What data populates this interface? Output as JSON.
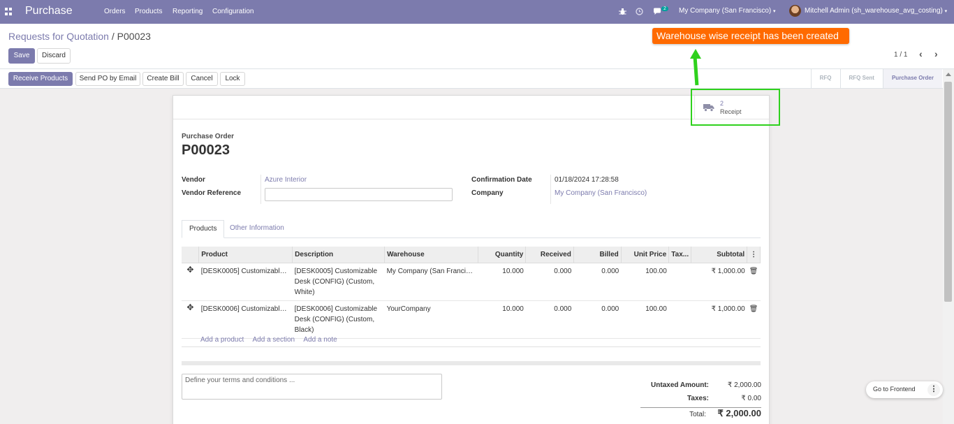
{
  "navbar": {
    "app_name": "Purchase",
    "menu": [
      "Orders",
      "Products",
      "Reporting",
      "Configuration"
    ],
    "messages_count": "2",
    "company": "My Company (San Francisco)",
    "user": "Mitchell Admin (sh_warehouse_avg_costing)"
  },
  "breadcrumb": {
    "parent": "Requests for Quotation",
    "separator": "/",
    "current": "P00023"
  },
  "actions": {
    "save": "Save",
    "discard": "Discard"
  },
  "pager": {
    "text": "1 / 1"
  },
  "annotation": {
    "text": "Warehouse wise receipt has been created",
    "color": "#ff6a00",
    "arrow_color": "#2fd11d"
  },
  "header_buttons": {
    "receive": "Receive Products",
    "send_po": "Send PO by Email",
    "create_bill": "Create Bill",
    "cancel": "Cancel",
    "lock": "Lock"
  },
  "stages": [
    "RFQ",
    "RFQ Sent",
    "Purchase Order"
  ],
  "active_stage": "Purchase Order",
  "smart_button": {
    "value": "2",
    "label": "Receipt"
  },
  "form": {
    "title_label": "Purchase Order",
    "name": "P00023",
    "vendor_label": "Vendor",
    "vendor": "Azure Interior",
    "vendor_ref_label": "Vendor Reference",
    "vendor_ref": "",
    "confirmation_date_label": "Confirmation Date",
    "confirmation_date": "01/18/2024 17:28:58",
    "company_label": "Company",
    "company": "My Company (San Francisco)"
  },
  "tabs": [
    "Products",
    "Other Information"
  ],
  "table": {
    "columns": [
      "Product",
      "Description",
      "Warehouse",
      "Quantity",
      "Received",
      "Billed",
      "Unit Price",
      "Tax...",
      "Subtotal"
    ],
    "rows": [
      {
        "product": "[DESK0005] Customizable Desk (CONFIG) (Custom, White)",
        "description": [
          "[DESK0005] Customizable",
          "Desk (CONFIG) (Custom,",
          "White)"
        ],
        "warehouse": "My Company (San Francisco)",
        "quantity": "10.000",
        "received": "0.000",
        "billed": "0.000",
        "unit_price": "100.00",
        "taxes": "",
        "subtotal": "₹ 1,000.00"
      },
      {
        "product": "[DESK0006] Customizable Desk (CONFIG) (Custom, Black)",
        "description": [
          "[DESK0006] Customizable",
          "Desk (CONFIG) (Custom,",
          "Black)"
        ],
        "warehouse": "YourCompany",
        "quantity": "10.000",
        "received": "0.000",
        "billed": "0.000",
        "unit_price": "100.00",
        "taxes": "",
        "subtotal": "₹ 1,000.00"
      }
    ],
    "add_links": [
      "Add a product",
      "Add a section",
      "Add a note"
    ]
  },
  "terms_placeholder": "Define your terms and conditions ...",
  "totals": {
    "untaxed_label": "Untaxed Amount:",
    "untaxed": "₹ 2,000.00",
    "taxes_label": "Taxes:",
    "taxes": "₹ 0.00",
    "total_label": "Total:",
    "total": "₹ 2,000.00"
  },
  "frontend_button": "Go to Frontend",
  "colors": {
    "brand": "#7c7bad",
    "highlight_box": "#2fd11d"
  }
}
